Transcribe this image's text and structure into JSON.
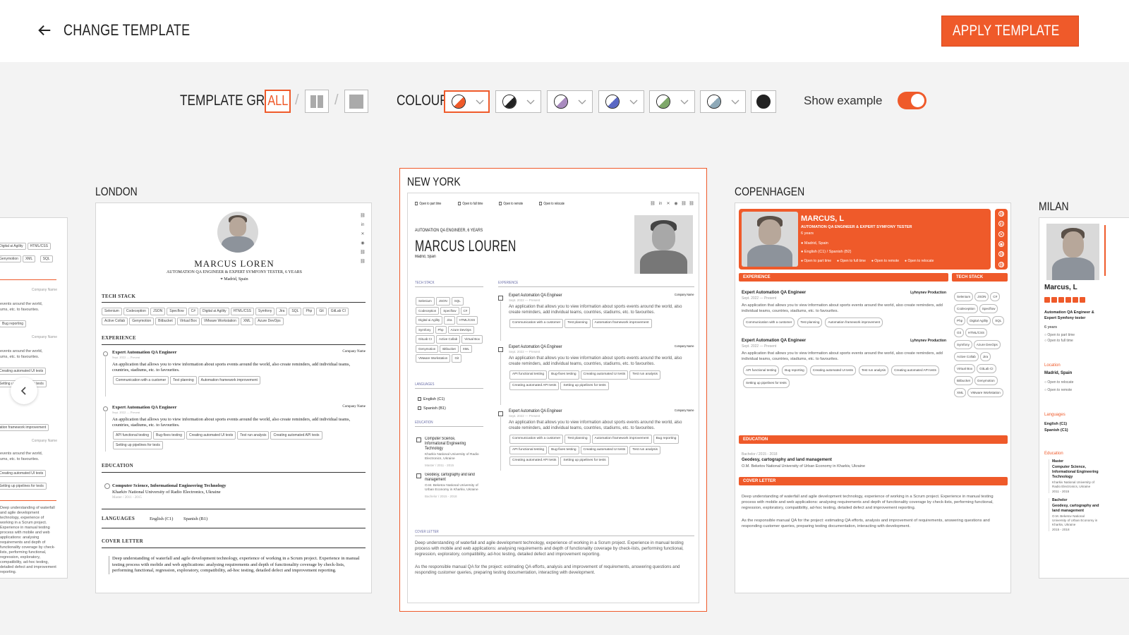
{
  "header": {
    "back_label": "CHANGE TEMPLATE",
    "apply_label": "APPLY TEMPLATE"
  },
  "toolbar": {
    "grid_label": "TEMPLATE GRID",
    "grid_options": [
      "ALL"
    ],
    "colour_label": "COLOUR",
    "swatches": [
      "#ef5a2a",
      "#222222",
      "#a98bbf",
      "#5a68c4",
      "#7fa86a",
      "#8ea9b8",
      "#222222"
    ],
    "show_example_label": "Show example",
    "show_example_on": true
  },
  "templates": {
    "london": {
      "name": "LONDON",
      "person": "MARCUS LOREN",
      "role": "AUTOMATION QA ENGINEER & EXPERT SYMFONY TESTER, 6 YEARS",
      "location": "Madrid, Spain",
      "tech_stack_title": "TECH STACK",
      "tech_stack": [
        "Selenium",
        "Codeception",
        "JSON",
        "Specflow",
        "C#",
        "Digital ai Agility",
        "HTML/CSS",
        "Symfony",
        "Jira",
        "SQL",
        "Php",
        "Git",
        "GitLab CI",
        "Active Collab",
        "Genymotion",
        "Bitbucket",
        "Virtual Box",
        "VMware Workstation",
        "XML",
        "Azure DevOps"
      ],
      "experience_title": "EXPERIENCE",
      "jobs": [
        {
          "title": "Expert Automation QA Engineer",
          "company": "Company Name",
          "date": "Sept. 2022 — Present",
          "desc": "An application that allows you to view information about sports events around the world, also create reminders, add individual teams, countries, stadiums, etc. to favourites.",
          "tags": [
            "Communication with a customer",
            "Test planning",
            "Automation framework improvement"
          ]
        },
        {
          "title": "Expert Automation QA Engineer",
          "company": "Company Name",
          "date": "Sept. 2022 — Present",
          "desc": "An application that allows you to view information about sports events around the world, also create reminders, add individual teams, countries, stadiums, etc. to favourites.",
          "tags": [
            "API functional testing",
            "Bug-fixes testing",
            "Creating automated UI tests",
            "Test run analysis",
            "Creating automated API tests",
            "Setting up pipelines for tests"
          ]
        }
      ],
      "education_title": "EDUCATION",
      "edu_degree": "Computer Science, Informational Engineering Technology",
      "edu_school": "Kharkiv National University of Radio Electronics, Ukraine",
      "edu_meta": "Master  /  2011 - 2015",
      "languages_title": "LANGUAGES",
      "languages": [
        "English  (C1)",
        "Spanish  (B1)"
      ],
      "cover_title": "COVER LETTER",
      "cover": "Deep understanding of waterfall and agile development technology, experience of working in a Scrum project. Experience in manual testing process with mobile and web applications: analysing requirements and depth of functionality coverage by check-lists, performing functional, regression, exploratory, compatibility, ad-hoc testing, detailed defect and improvement reporting."
    },
    "newyork": {
      "name": "NEW YORK",
      "checks": [
        "Open to part time",
        "Open to full time",
        "Open to remote",
        "Open to relocate"
      ],
      "role": "AUTOMATION QA ENGINEER, 6 YEARS",
      "person": "MARCUS LOUREN",
      "location": "Madrid, Spain",
      "tech_stack_title": "TECH STACK",
      "tech_stack": [
        "Selenium",
        "JSON",
        "SQL",
        "Codeception",
        "Specflow",
        "C#",
        "Digital ai Agility",
        "Jira",
        "HTML/CSS",
        "Symfony",
        "Php",
        "Azure DevOps",
        "GitLab CI",
        "Active Collab",
        "Virtual Box",
        "Genymotion",
        "Bitbucket",
        "XML",
        "VMware Workstation",
        "Git"
      ],
      "languages_title": "LANGUAGES",
      "languages": [
        "English  (C1)",
        "Spanish  (B1)"
      ],
      "education_title": "EDUCATION",
      "edu": [
        {
          "degree": "Computer Science, Informational Engineering Technology",
          "school": "Kharkiv National University of Radio Electronics, Ukraine",
          "meta": "Master  /  2011 - 2015"
        },
        {
          "degree": "Geodesy, cartography and land management",
          "school": "O.M. Beketov National University of Urban Economy in Kharkiv, Ukraine",
          "meta": "Bachelor  /  2015 - 2018"
        }
      ],
      "experience_title": "EXPERIENCE",
      "jobs": [
        {
          "title": "Expert Automation QA Engineer",
          "company": "Company Name",
          "date": "Sept. 2022 — Present",
          "desc": "An application that allows you to view information about sports events around the world, also create reminders, add individual teams, countries, stadiums, etc. to favourites.",
          "tags": [
            "Communication with a customer",
            "Test planning",
            "Automation framework improvement"
          ]
        },
        {
          "title": "Expert Automation QA Engineer",
          "company": "Company Name",
          "date": "Sept. 2022 — Present",
          "desc": "An application that allows you to view information about sports events around the world, also create reminders, add individual teams, countries, stadiums, etc. to favourites.",
          "tags": [
            "API functional testing",
            "Bug-fixes testing",
            "Creating automated UI tests",
            "Test run analysis",
            "Creating automated API tests",
            "Setting up pipelines for tests"
          ]
        },
        {
          "title": "Expert Automation QA Engineer",
          "company": "Company Name",
          "date": "Sept. 2022 — Present",
          "desc": "An application that allows you to view information about sports events around the world, also create reminders, add individual teams, countries, stadiums, etc. to favourites.",
          "tags": [
            "Communication with a customer",
            "Test planning",
            "Automation framework improvement",
            "Bug reporting",
            "API functional testing",
            "Bug-fixes testing",
            "Creating automated UI tests",
            "Test run analysis",
            "Creating automated API tests",
            "Setting up pipelines for tests"
          ]
        }
      ],
      "cover_title": "COVER LETTER",
      "cover1": "Deep understanding of waterfall and agile development technology, experience of working in a Scrum project. Experience in manual testing process with mobile and web applications: analysing requirements and depth of functionality coverage by check-lists, performing functional, regression, exploratory, compatibility, ad-hoc testing, detailed defect and improvement reporting.",
      "cover2": "As the responsible manual QA for the project: estimating QA efforts, analysis and improvement of requirements, answering questions and responding customer queries, preparing testing documentation, interacting with development."
    },
    "copenhagen": {
      "name": "COPENHAGEN",
      "person": "MARCUS, L",
      "role": "AUTOMATION QA ENGINEER & EXPERT SYMFONY TESTER",
      "years": "6 years",
      "location": "Madrid, Spain",
      "langs": "English  (C1)   /   Spanish  (B2)",
      "checks": [
        "Open to part time",
        "Open to full time",
        "Open to remote",
        "Open to relocate"
      ],
      "experience_title": "EXPERIENCE",
      "tech_title": "TECH STACK",
      "tech_stack": [
        "Selenium",
        "JSON",
        "C#",
        "Codeception",
        "Specflow",
        "Php",
        "Digital Agility",
        "SQL",
        "Git",
        "HTML/CSS",
        "Symfony",
        "Azure DevOps",
        "Active Collab",
        "Jira",
        "Virtual Box",
        "GitLab CI",
        "Bitbucket",
        "Genymotion",
        "XML",
        "VMware Workstation"
      ],
      "jobs": [
        {
          "title": "Expert Automation QA Engineer",
          "company": "Lyhnynev Production",
          "date": "Sept. 2022 — Present",
          "desc": "An application that allows you to view information about sports events around the world, also create reminders, add individual teams, countries, stadiums, etc. to favourites.",
          "tags": [
            "Communication with a customer",
            "Test planning",
            "Automation framework improvement"
          ]
        },
        {
          "title": "Expert Automation QA Engineer",
          "company": "Lyhnynev Production",
          "date": "Sept. 2022 — Present",
          "desc": "An application that allows you to view information about sports events around the world, also create reminders, add individual teams, countries, stadiums, etc. to favourites.",
          "tags": [
            "API functional testing",
            "Bug reporting",
            "Creating automated UI tests",
            "Test run analysis",
            "Creating automated API tests",
            "Setting up pipelines for tests"
          ]
        }
      ],
      "education_title": "EDUCATION",
      "edu_meta": "Bachelor  /  2015 - 2018",
      "edu_degree": "Geodesy, cartography and land management",
      "edu_school": "O.M. Beketov National University of Urban Economy in Kharkiv, Ukraine",
      "cover_title": "COVER LETTER",
      "cover1": "Deep understanding of waterfall and agile development technology, experience of working in a Scrum project. Experience in manual testing process with mobile and web applications: analysing requirements and depth of functionality coverage by check-lists, performing functional, regression, exploratory, compatibility, ad-hoc testing, detailed defect and improvement reporting.",
      "cover2": "As the responsible manual QA for the project: estimating QA efforts, analysis and improvement of requirements, answering questions and responding customer queries, preparing testing documentation, interacting with development."
    },
    "milan": {
      "name": "MILAN",
      "person": "Marcus, L",
      "role": "Automation QA Engineer & Expert Symfony tester",
      "years": "6 years",
      "checks": [
        "Open to part time",
        "Open to full time"
      ],
      "location_title": "Location",
      "location": "Madrid, Spain",
      "checks2": [
        "Open to relocate",
        "Open to remote"
      ],
      "languages_title": "Languages",
      "languages": [
        "English    (C1)",
        "Spanish    (C1)"
      ],
      "education_title": "Education",
      "edu": [
        {
          "meta": "Master",
          "degree": "Computer Science, Informational Engineering Technology",
          "school": "Kharkiv National University of Radio Electronics, Ukraine",
          "years": "2011 - 2015"
        },
        {
          "meta": "Bachelor",
          "degree": "Geodesy, cartography and land management",
          "school": "O.M. Beketov National University of Urban Economy in Kharkiv, Ukraine",
          "years": "2015 - 2018"
        }
      ]
    },
    "left_partial": {
      "tags": [
        "Digital ai Agility",
        "HTML/CSS",
        "Jira",
        "Genymotion",
        "XML",
        "SQL",
        "Bug reporting",
        "Test planning",
        "Automation framework improvement",
        "Creating automated UI tests",
        "Setting up pipelines for tests"
      ],
      "company": "Company Name",
      "desc1": "events around the world,",
      "desc2": "ums, etc. to favourites."
    }
  }
}
